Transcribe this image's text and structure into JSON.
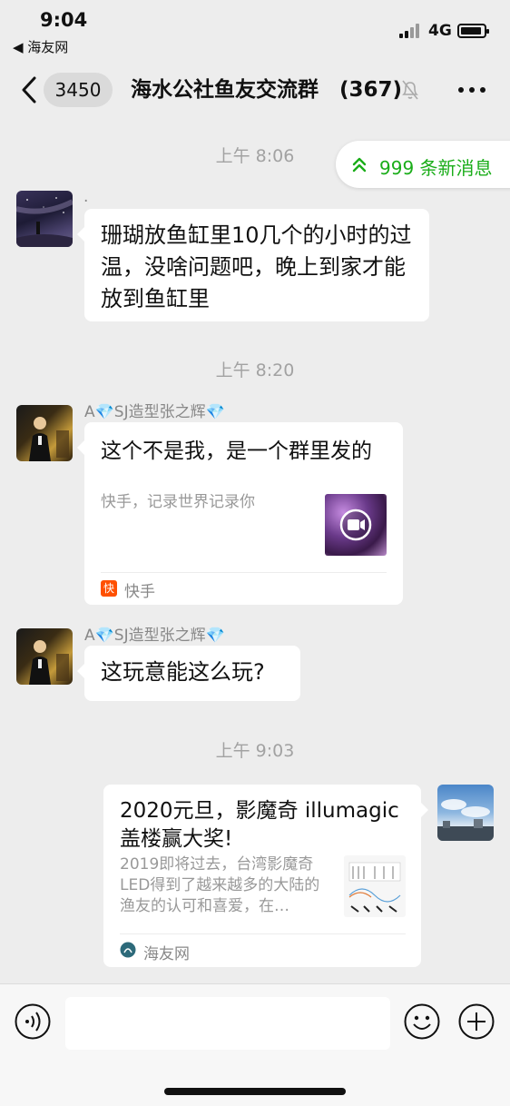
{
  "status_bar": {
    "time": "9:04",
    "back_app": "◀ 海友网",
    "network": "4G"
  },
  "nav": {
    "unread": "3450",
    "title": "海水公社鱼友交流群",
    "member_count": "(367)"
  },
  "new_messages": {
    "label": "999 条新消息"
  },
  "timestamps": [
    "上午 8:06",
    "上午 8:20",
    "上午 9:03"
  ],
  "messages": [
    {
      "sender": ".",
      "text": "珊瑚放鱼缸里10几个的小时的过温，没啥问题吧，晚上到家才能放到鱼缸里"
    },
    {
      "sender": "A💎SJ造型张之辉💎",
      "title": "这个不是我，是一个群里发的",
      "desc": "快手，记录世界记录你",
      "source": "快手",
      "source_icon_text": "快"
    },
    {
      "sender": "A💎SJ造型张之辉💎",
      "text": "这玩意能这么玩?"
    },
    {
      "title": "2020元旦，影魔奇 illumagic 盖楼赢大奖!",
      "desc": "2019即将过去，台湾影魔奇LED得到了越来越多的大陆的渔友的认可和喜爱，在…",
      "source": "海友网"
    }
  ],
  "colors": {
    "background": "#ededed",
    "accent_green": "#1aad19",
    "bubble": "#ffffff",
    "timestamp": "#a2a2a2",
    "kuaishou_orange": "#ff5000"
  },
  "icons": [
    "back-chevron-icon",
    "mute-bell-icon",
    "more-icon",
    "double-chevron-up-icon",
    "video-play-icon",
    "voice-icon",
    "emoji-icon",
    "plus-icon"
  ]
}
